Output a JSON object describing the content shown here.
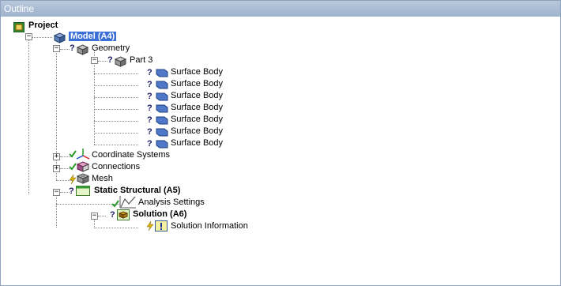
{
  "panel": {
    "title": "Outline"
  },
  "tree": {
    "root": {
      "label": "Project"
    },
    "model": {
      "label": "Model (A4)",
      "expander": "−"
    },
    "geometry": {
      "label": "Geometry",
      "status": "?",
      "expander": "−"
    },
    "part": {
      "label": "Part 3",
      "status": "?",
      "expander": "−"
    },
    "bodies": [
      {
        "label": "Surface Body",
        "status": "?"
      },
      {
        "label": "Surface Body",
        "status": "?"
      },
      {
        "label": "Surface Body",
        "status": "?"
      },
      {
        "label": "Surface Body",
        "status": "?"
      },
      {
        "label": "Surface Body",
        "status": "?"
      },
      {
        "label": "Surface Body",
        "status": "?"
      },
      {
        "label": "Surface Body",
        "status": "?"
      }
    ],
    "coordinate_systems": {
      "label": "Coordinate Systems",
      "expander": "+"
    },
    "connections": {
      "label": "Connections",
      "expander": "+"
    },
    "mesh": {
      "label": "Mesh"
    },
    "static_structural": {
      "label": "Static Structural (A5)",
      "status": "?",
      "expander": "−"
    },
    "analysis_settings": {
      "label": "Analysis Settings"
    },
    "solution": {
      "label": "Solution (A6)",
      "status": "?",
      "expander": "−"
    },
    "solution_information": {
      "label": "Solution Information"
    }
  },
  "colors": {
    "selection": "#3a6fd8",
    "titlebar": "#a9bbd2",
    "check": "#2a9a2a",
    "lightning": "#d8b400",
    "body_icon": "#4f78c8"
  }
}
